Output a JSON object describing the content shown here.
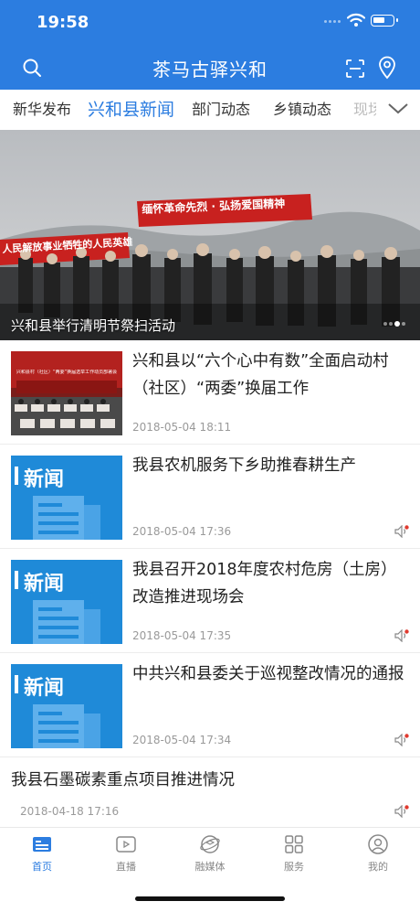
{
  "status": {
    "time": "19:58"
  },
  "header": {
    "title": "茶马古驿兴和",
    "icons": [
      "search-icon",
      "scan-icon",
      "location-icon"
    ]
  },
  "tabs": [
    {
      "label": "新华发布",
      "active": false
    },
    {
      "label": "兴和县新闻",
      "active": true
    },
    {
      "label": "部门动态",
      "active": false
    },
    {
      "label": "乡镇动态",
      "active": false
    },
    {
      "label": "现场",
      "active": false
    }
  ],
  "hero": {
    "caption": "兴和县举行清明节祭扫活动",
    "banner_text": "缅怀革命先烈 · 弘扬爱国精神",
    "banner_text_left": "人民解放事业牺牲的人民英雄",
    "slide_count": 4,
    "active_slide": 2
  },
  "news": [
    {
      "title": "兴和县以“六个心中有数”全面启动村（社区）“两委”换届工作",
      "date": "2018-05-04 18:11",
      "thumb": "photo",
      "thumb_text": "兴和县村（社区）“两委”换届选举工作动员部署会",
      "has_audio": false
    },
    {
      "title": "我县农机服务下乡助推春耕生产",
      "date": "2018-05-04 17:36",
      "thumb": "news",
      "thumb_text": "新闻",
      "has_audio": true
    },
    {
      "title": "我县召开2018年度农村危房（土房）改造推进现场会",
      "date": "2018-05-04 17:35",
      "thumb": "news",
      "thumb_text": "新闻",
      "has_audio": true
    },
    {
      "title": "中共兴和县委关于巡视整改情况的通报",
      "date": "2018-05-04 17:34",
      "thumb": "news",
      "thumb_text": "新闻",
      "has_audio": true
    },
    {
      "title": "我县石墨碳素重点项目推进情况",
      "date": "2018-04-18 17:16",
      "thumb": "none",
      "has_audio": true
    }
  ],
  "tabbar": [
    {
      "label": "首页",
      "icon": "home-icon",
      "active": true
    },
    {
      "label": "直播",
      "icon": "live-icon",
      "active": false
    },
    {
      "label": "融媒体",
      "icon": "media-icon",
      "active": false
    },
    {
      "label": "服务",
      "icon": "services-icon",
      "active": false
    },
    {
      "label": "我的",
      "icon": "profile-icon",
      "active": false
    }
  ],
  "colors": {
    "brand": "#2c7de0",
    "news_thumb": "#1f8ad8",
    "audio_dot": "#e03a2f"
  }
}
